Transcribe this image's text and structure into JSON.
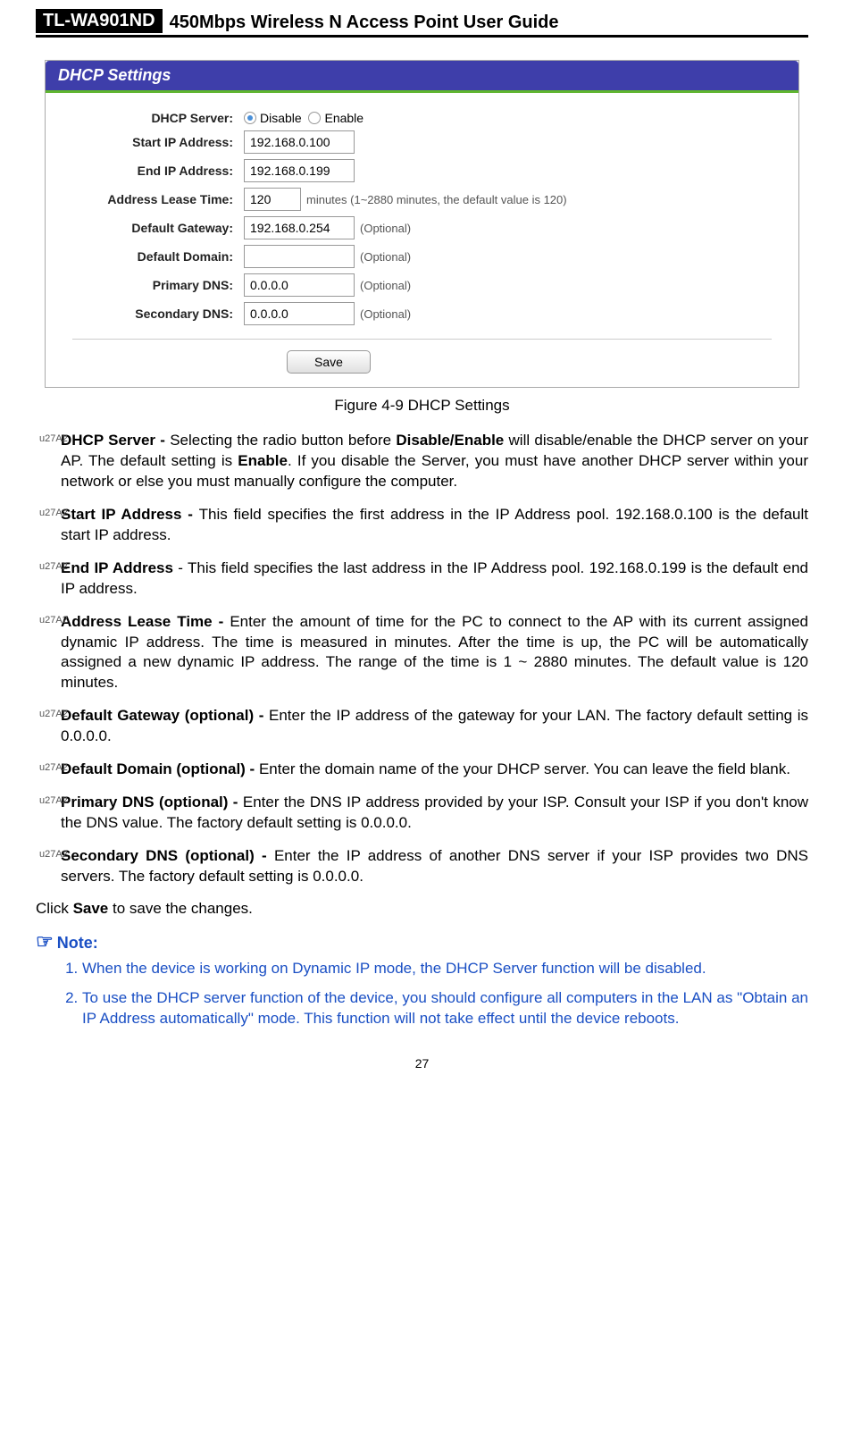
{
  "header": {
    "model": "TL-WA901ND",
    "title": "450Mbps Wireless N Access Point User Guide"
  },
  "panel": {
    "title": "DHCP Settings",
    "rows": {
      "dhcp_server_label": "DHCP Server:",
      "disable": "Disable",
      "enable": "Enable",
      "start_ip_label": "Start IP Address:",
      "start_ip": "192.168.0.100",
      "end_ip_label": "End IP Address:",
      "end_ip": "192.168.0.199",
      "lease_label": "Address Lease Time:",
      "lease_val": "120",
      "lease_hint": "minutes (1~2880 minutes, the default value is 120)",
      "gateway_label": "Default Gateway:",
      "gateway_val": "192.168.0.254",
      "optional": "(Optional)",
      "domain_label": "Default Domain:",
      "domain_val": "",
      "pdns_label": "Primary DNS:",
      "pdns_val": "0.0.0.0",
      "sdns_label": "Secondary DNS:",
      "sdns_val": "0.0.0.0"
    },
    "save": "Save"
  },
  "caption": "Figure 4-9 DHCP Settings",
  "bullets": [
    {
      "lead": "DHCP Server - ",
      "pre": "Selecting the radio button before ",
      "mid_bold": "Disable/Enable",
      "post_mid": " will disable/enable the DHCP server on your AP. The default setting is ",
      "mid_bold2": "Enable",
      "tail": ". If you disable the Server, you must have another DHCP server within your network or else you must manually configure the computer."
    },
    {
      "lead": "Start IP Address - ",
      "text": "This field specifies the first address in the IP Address pool. 192.168.0.100 is the default start IP address."
    },
    {
      "lead": "End IP Address ",
      "dash": "- ",
      "text": "This field specifies the last address in the IP Address pool. 192.168.0.199 is the default end IP address."
    },
    {
      "lead": "Address Lease Time - ",
      "text": "Enter the amount of time for the PC to connect to the AP with its current assigned dynamic IP address. The time is measured in minutes. After the time is up, the PC will be automatically assigned a new dynamic IP address. The range of the time is 1 ~ 2880 minutes. The default value is 120 minutes."
    },
    {
      "lead": "Default Gateway (optional) - ",
      "text": "Enter the IP address of the gateway for your LAN. The factory default setting is 0.0.0.0."
    },
    {
      "lead": "Default Domain (optional) - ",
      "text": "Enter the domain name of the your DHCP server. You can leave the field blank."
    },
    {
      "lead": "Primary DNS (optional) - ",
      "text": "Enter the DNS IP address provided by your ISP. Consult your ISP if you don't know the DNS value. The factory default setting is 0.0.0.0."
    },
    {
      "lead": "Secondary DNS (optional) - ",
      "text": "Enter the IP address of another DNS server if your ISP provides two DNS servers. The factory default setting is 0.0.0.0."
    }
  ],
  "click_save_pre": "Click ",
  "click_save_bold": "Save",
  "click_save_post": " to save the changes.",
  "note_label": "Note:",
  "notes": [
    "When the device is working on Dynamic IP mode, the DHCP Server function will be disabled.",
    "To use the DHCP server function of the device, you should configure all computers in the LAN as \"Obtain an IP Address automatically\" mode. This function will not take effect until the device reboots."
  ],
  "page_num": "27"
}
